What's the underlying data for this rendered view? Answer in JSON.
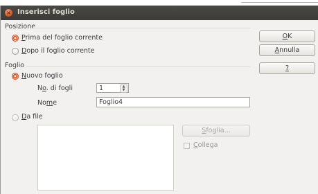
{
  "dialog": {
    "title": "Inserisci foglio",
    "close_icon": "close-icon"
  },
  "position": {
    "label": "Posizione",
    "before_prefix": "",
    "before_key": "P",
    "before_rest": "rima del foglio corrente",
    "before_selected": true,
    "after_key": "D",
    "after_rest": "opo il foglio corrente",
    "after_selected": false
  },
  "sheet": {
    "label": "Foglio",
    "new_key": "N",
    "new_rest": "uovo foglio",
    "new_selected": true,
    "count_label_pre": "N",
    "count_label_key": "o",
    "count_label_post": ". di fogli",
    "count_value": "1",
    "name_label_pre": "No",
    "name_label_key": "m",
    "name_label_post": "e",
    "name_value": "Foglio4",
    "from_file_key": "D",
    "from_file_rest": "a file",
    "from_file_selected": false,
    "browse_pre": "",
    "browse_key": "S",
    "browse_rest": "foglia...",
    "link_key": "C",
    "link_rest": "ollega"
  },
  "buttons": {
    "ok_key": "O",
    "ok_rest": "K",
    "cancel_key": "A",
    "cancel_rest": "nnulla",
    "help_label": "?"
  },
  "colors": {
    "titlebar": "#3c3b37",
    "accent": "#e0561f",
    "dialog_bg": "#f2f1f0"
  }
}
